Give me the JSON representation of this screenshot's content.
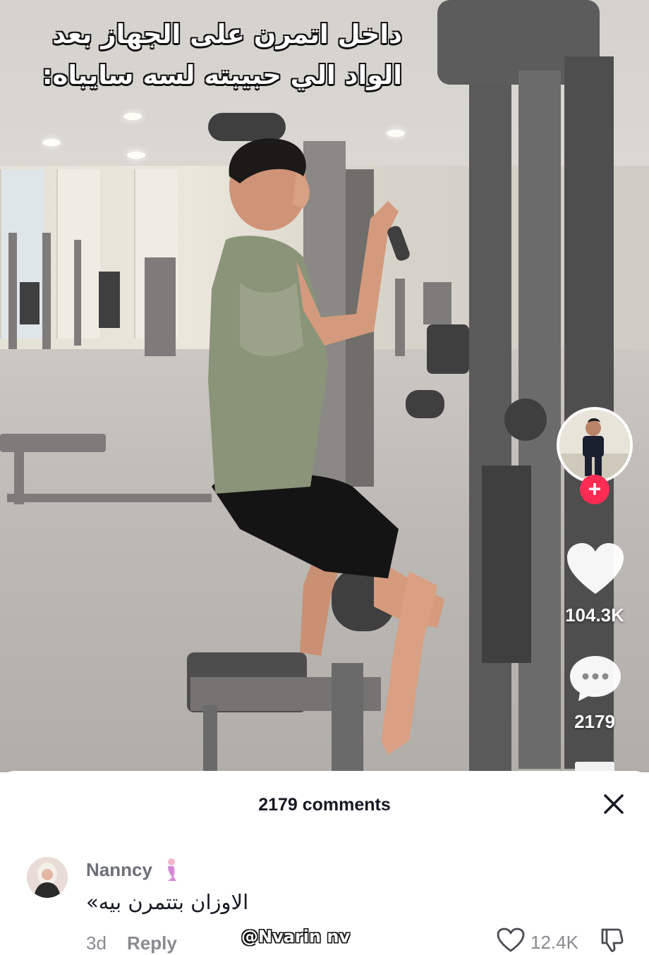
{
  "video": {
    "caption_line1": "داخل اتمرن على الجهاز بعد",
    "caption_line2": "الواد الي حبيبته لسه سايباه:",
    "follow_icon": "plus-icon",
    "likes": "104.3K",
    "comments_count": "2179",
    "accent": "#fe2c55"
  },
  "comments_sheet": {
    "title": "2179 comments",
    "close_icon": "close-icon",
    "comments": [
      {
        "username": "Nanncy",
        "user_emoji": "mermaid-icon",
        "text": "الاوزان بتتمرن بيه»",
        "time": "3d",
        "reply_label": "Reply",
        "likes": "12.4K"
      }
    ]
  },
  "watermark": "@Nvarin nv"
}
